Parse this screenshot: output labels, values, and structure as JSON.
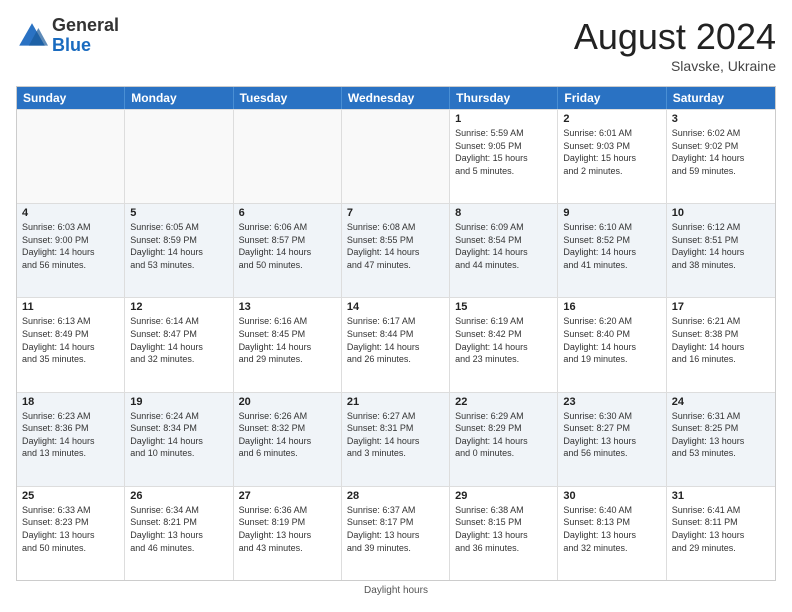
{
  "logo": {
    "general": "General",
    "blue": "Blue"
  },
  "title": "August 2024",
  "subtitle": "Slavske, Ukraine",
  "header_days": [
    "Sunday",
    "Monday",
    "Tuesday",
    "Wednesday",
    "Thursday",
    "Friday",
    "Saturday"
  ],
  "footer": "Daylight hours",
  "rows": [
    [
      {
        "day": "",
        "info": "",
        "empty": true
      },
      {
        "day": "",
        "info": "",
        "empty": true
      },
      {
        "day": "",
        "info": "",
        "empty": true
      },
      {
        "day": "",
        "info": "",
        "empty": true
      },
      {
        "day": "1",
        "info": "Sunrise: 5:59 AM\nSunset: 9:05 PM\nDaylight: 15 hours\nand 5 minutes."
      },
      {
        "day": "2",
        "info": "Sunrise: 6:01 AM\nSunset: 9:03 PM\nDaylight: 15 hours\nand 2 minutes."
      },
      {
        "day": "3",
        "info": "Sunrise: 6:02 AM\nSunset: 9:02 PM\nDaylight: 14 hours\nand 59 minutes."
      }
    ],
    [
      {
        "day": "4",
        "info": "Sunrise: 6:03 AM\nSunset: 9:00 PM\nDaylight: 14 hours\nand 56 minutes."
      },
      {
        "day": "5",
        "info": "Sunrise: 6:05 AM\nSunset: 8:59 PM\nDaylight: 14 hours\nand 53 minutes."
      },
      {
        "day": "6",
        "info": "Sunrise: 6:06 AM\nSunset: 8:57 PM\nDaylight: 14 hours\nand 50 minutes."
      },
      {
        "day": "7",
        "info": "Sunrise: 6:08 AM\nSunset: 8:55 PM\nDaylight: 14 hours\nand 47 minutes."
      },
      {
        "day": "8",
        "info": "Sunrise: 6:09 AM\nSunset: 8:54 PM\nDaylight: 14 hours\nand 44 minutes."
      },
      {
        "day": "9",
        "info": "Sunrise: 6:10 AM\nSunset: 8:52 PM\nDaylight: 14 hours\nand 41 minutes."
      },
      {
        "day": "10",
        "info": "Sunrise: 6:12 AM\nSunset: 8:51 PM\nDaylight: 14 hours\nand 38 minutes."
      }
    ],
    [
      {
        "day": "11",
        "info": "Sunrise: 6:13 AM\nSunset: 8:49 PM\nDaylight: 14 hours\nand 35 minutes."
      },
      {
        "day": "12",
        "info": "Sunrise: 6:14 AM\nSunset: 8:47 PM\nDaylight: 14 hours\nand 32 minutes."
      },
      {
        "day": "13",
        "info": "Sunrise: 6:16 AM\nSunset: 8:45 PM\nDaylight: 14 hours\nand 29 minutes."
      },
      {
        "day": "14",
        "info": "Sunrise: 6:17 AM\nSunset: 8:44 PM\nDaylight: 14 hours\nand 26 minutes."
      },
      {
        "day": "15",
        "info": "Sunrise: 6:19 AM\nSunset: 8:42 PM\nDaylight: 14 hours\nand 23 minutes."
      },
      {
        "day": "16",
        "info": "Sunrise: 6:20 AM\nSunset: 8:40 PM\nDaylight: 14 hours\nand 19 minutes."
      },
      {
        "day": "17",
        "info": "Sunrise: 6:21 AM\nSunset: 8:38 PM\nDaylight: 14 hours\nand 16 minutes."
      }
    ],
    [
      {
        "day": "18",
        "info": "Sunrise: 6:23 AM\nSunset: 8:36 PM\nDaylight: 14 hours\nand 13 minutes."
      },
      {
        "day": "19",
        "info": "Sunrise: 6:24 AM\nSunset: 8:34 PM\nDaylight: 14 hours\nand 10 minutes."
      },
      {
        "day": "20",
        "info": "Sunrise: 6:26 AM\nSunset: 8:32 PM\nDaylight: 14 hours\nand 6 minutes."
      },
      {
        "day": "21",
        "info": "Sunrise: 6:27 AM\nSunset: 8:31 PM\nDaylight: 14 hours\nand 3 minutes."
      },
      {
        "day": "22",
        "info": "Sunrise: 6:29 AM\nSunset: 8:29 PM\nDaylight: 14 hours\nand 0 minutes."
      },
      {
        "day": "23",
        "info": "Sunrise: 6:30 AM\nSunset: 8:27 PM\nDaylight: 13 hours\nand 56 minutes."
      },
      {
        "day": "24",
        "info": "Sunrise: 6:31 AM\nSunset: 8:25 PM\nDaylight: 13 hours\nand 53 minutes."
      }
    ],
    [
      {
        "day": "25",
        "info": "Sunrise: 6:33 AM\nSunset: 8:23 PM\nDaylight: 13 hours\nand 50 minutes."
      },
      {
        "day": "26",
        "info": "Sunrise: 6:34 AM\nSunset: 8:21 PM\nDaylight: 13 hours\nand 46 minutes."
      },
      {
        "day": "27",
        "info": "Sunrise: 6:36 AM\nSunset: 8:19 PM\nDaylight: 13 hours\nand 43 minutes."
      },
      {
        "day": "28",
        "info": "Sunrise: 6:37 AM\nSunset: 8:17 PM\nDaylight: 13 hours\nand 39 minutes."
      },
      {
        "day": "29",
        "info": "Sunrise: 6:38 AM\nSunset: 8:15 PM\nDaylight: 13 hours\nand 36 minutes."
      },
      {
        "day": "30",
        "info": "Sunrise: 6:40 AM\nSunset: 8:13 PM\nDaylight: 13 hours\nand 32 minutes."
      },
      {
        "day": "31",
        "info": "Sunrise: 6:41 AM\nSunset: 8:11 PM\nDaylight: 13 hours\nand 29 minutes."
      }
    ]
  ]
}
